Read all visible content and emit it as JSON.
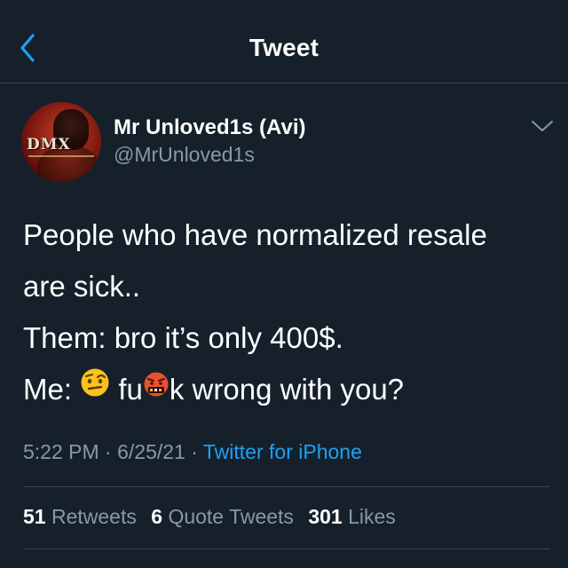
{
  "colors": {
    "background": "#15202b",
    "accent": "#1da1f2",
    "secondary_text": "#8899a6",
    "divider": "#38444d"
  },
  "nav": {
    "title": "Tweet",
    "back_icon": "chevron-left-icon"
  },
  "author": {
    "display_name": "Mr Unloved1s (Avi)",
    "handle": "@MrUnloved1s",
    "avatar_logo_text": "DMX",
    "more_icon": "chevron-down-icon"
  },
  "tweet": {
    "line1": "People who have normalized resale",
    "line2": "are sick..",
    "line3": "Them: bro it’s only 400$.",
    "line4_prefix": "Me:",
    "emoji_raised_eyebrow": "face-with-raised-eyebrow-emoji",
    "word_start": "fu",
    "emoji_censor": "face-with-symbols-on-mouth-emoji",
    "word_end": "k wrong with you?"
  },
  "meta": {
    "time": "5:22 PM",
    "separator": "·",
    "date": "6/25/21",
    "source": "Twitter for iPhone"
  },
  "stats": {
    "retweets_count": "51",
    "retweets_label": "Retweets",
    "quotes_count": "6",
    "quotes_label": "Quote Tweets",
    "likes_count": "301",
    "likes_label": "Likes"
  }
}
